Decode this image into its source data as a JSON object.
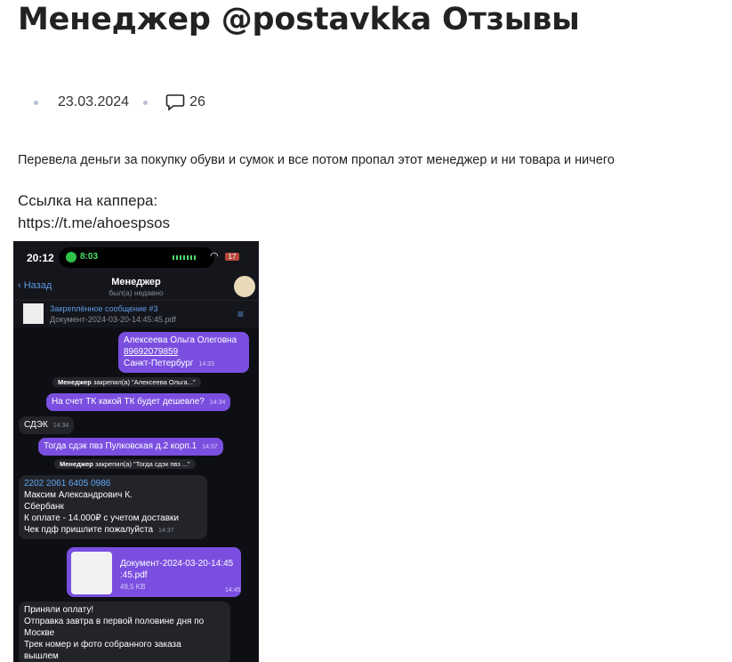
{
  "article": {
    "title": "Менеджер @postavkka Отзывы",
    "date": "23.03.2024",
    "comments": "26",
    "paragraph1": "Перевела деньги за покупку обуви и сумок и все потом пропал этот менеджер и ни товара и ничего",
    "link_label": "Ссылка на каппера:",
    "link_url": "https://t.me/ahoespsos"
  },
  "screenshot": {
    "status_time": "20:12",
    "call_time": "8:03",
    "battery": "17",
    "back_label": "Назад",
    "chat_name": "Менеджер",
    "chat_status": "был(а) недавно",
    "pinned_title": "Закреплённое сообщение #3",
    "pinned_doc": "Документ-2024-03-20-14:45:45.pdf",
    "messages": {
      "m1_l1": "Алексеева Ольга Олеговна",
      "m1_l2": "89692079859",
      "m1_l3": "Санкт-Петербург",
      "m1_time": "14:33",
      "sys1_bold": "Менеджер",
      "sys1_text": " закрепил(а) \"Алексеева Ольга...\"",
      "m2": "На счет ТК какой ТК будет дешевле?",
      "m2_time": "14:34",
      "m3": "СДЭК",
      "m3_time": "14:34",
      "m4": "Тогда сдэк пвз Пулковская д.2 корп.1",
      "m4_time": "14:37",
      "sys2_bold": "Менеджер",
      "sys2_text": " закрепил(а) \"Тогда сдэк пвз ...\"",
      "m5_card": "2202 2061 6405 0986",
      "m5_l2": "Максим Александрович К.",
      "m5_l3": "Сбербанк",
      "m5_l4": "К оплате - 14.000₽ с учетом доставки",
      "m5_l5": "Чек пдф пришлите пожалуйста",
      "m5_time": "14:37",
      "m6_name1": "Документ-2024-03-20-14:45",
      "m6_name2": ":45.pdf",
      "m6_size": "49,5 KB",
      "m6_time": "14:45",
      "m7_l1": "Приняли оплату!",
      "m7_l2": "Отправка завтра в первой половине дня по",
      "m7_l3": "Москве",
      "m7_l4": "Трек номер и фото собранного заказа",
      "m7_l5": "вышлем"
    }
  }
}
